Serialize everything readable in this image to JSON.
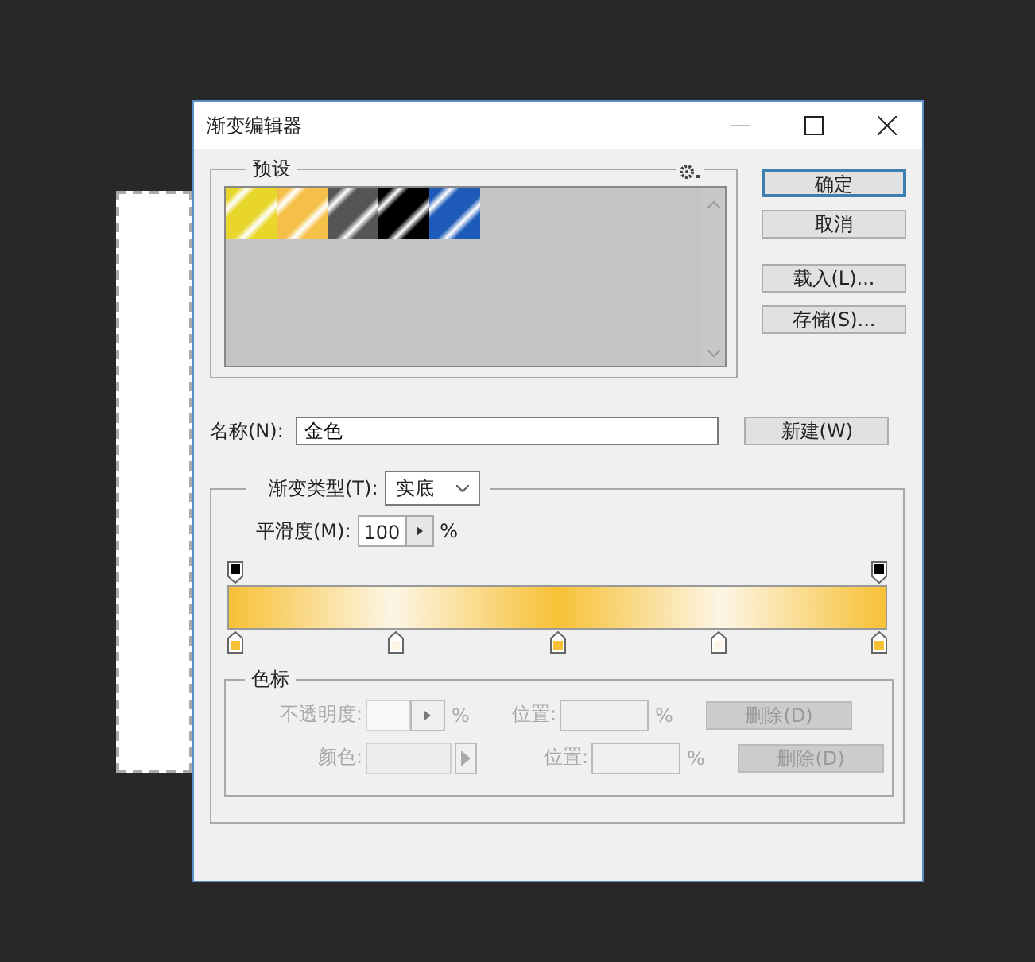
{
  "window": {
    "title": "渐变编辑器"
  },
  "presets": {
    "label": "预设",
    "swatches": [
      {
        "color": "#e8d62a",
        "selected": false
      },
      {
        "color": "#f5c048",
        "selected": false
      },
      {
        "color": "#555555",
        "selected": false
      },
      {
        "color": "#000000",
        "selected": false
      },
      {
        "color": "#1e5bb8",
        "selected": false
      }
    ]
  },
  "buttons": [
    {
      "label": "确定",
      "default": true
    },
    {
      "label": "取消",
      "default": false
    },
    {
      "label": "载入(L)...",
      "default": false
    },
    {
      "label": "存储(S)...",
      "default": false
    }
  ],
  "name": {
    "label": "名称(N):",
    "value": "金色",
    "button": "新建(W)"
  },
  "gradient_type": {
    "label": "渐变类型(T):",
    "value": "实底"
  },
  "smoothness": {
    "label": "平滑度(M):",
    "value": "100",
    "unit": "%"
  },
  "opacity_stops": [
    {
      "color": "#000000"
    },
    {
      "color": "#000000"
    }
  ],
  "color_stops": [
    {
      "color": "#f7c136"
    },
    {
      "color": "#fdf6e6"
    },
    {
      "color": "#f7c136"
    },
    {
      "color": "#fdf6e6"
    },
    {
      "color": "#f7c136"
    }
  ],
  "stops_panel": {
    "label": "色标",
    "rows": [
      {
        "kind": "opacity",
        "label": "不透明度:",
        "unit": "%",
        "position_label": "位置:",
        "position_unit": "%",
        "button": "删除(D)",
        "disabled": true
      },
      {
        "kind": "color",
        "label": "颜色:",
        "position_label": "位置:",
        "position_unit": "%",
        "button": "删除(D)",
        "disabled": true
      }
    ]
  }
}
